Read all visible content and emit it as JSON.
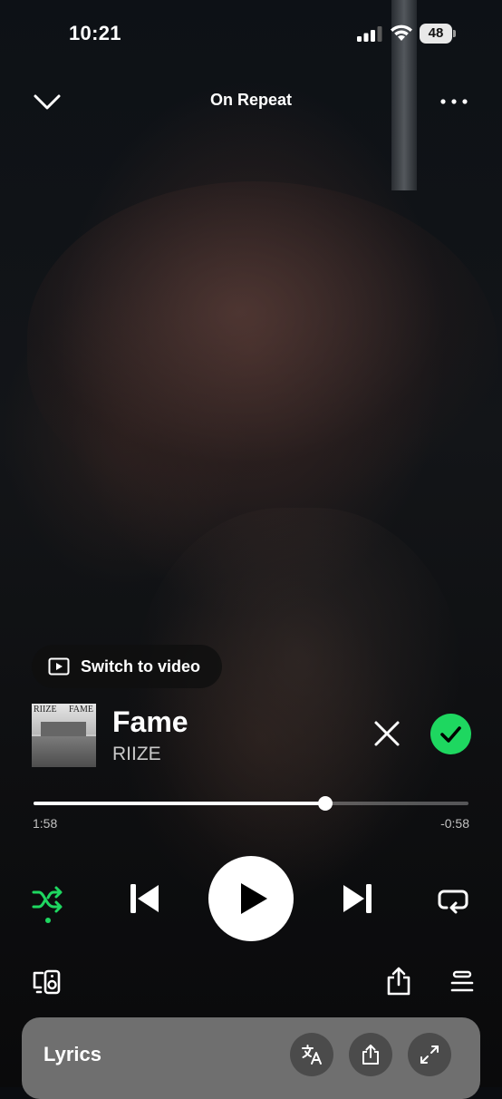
{
  "status_bar": {
    "time": "10:21",
    "battery": "48"
  },
  "header": {
    "title": "On Repeat"
  },
  "switch_video": {
    "label": "Switch to video"
  },
  "track": {
    "title": "Fame",
    "artist": "RIIZE",
    "cover_text_left": "RIIZE",
    "cover_text_right": "FAME"
  },
  "playback": {
    "elapsed": "1:58",
    "remaining": "-0:58",
    "progress_fraction": 0.67,
    "shuffle_active": true,
    "state": "paused"
  },
  "lyrics": {
    "label": "Lyrics"
  },
  "colors": {
    "accent": "#1ed760",
    "card": "#6f6f6f"
  },
  "icons": [
    "chevron-down-icon",
    "more-icon",
    "video-icon",
    "close-icon",
    "check-icon",
    "shuffle-icon",
    "previous-icon",
    "play-icon",
    "next-icon",
    "repeat-icon",
    "connect-devices-icon",
    "share-icon",
    "queue-icon",
    "translate-icon",
    "expand-icon"
  ]
}
